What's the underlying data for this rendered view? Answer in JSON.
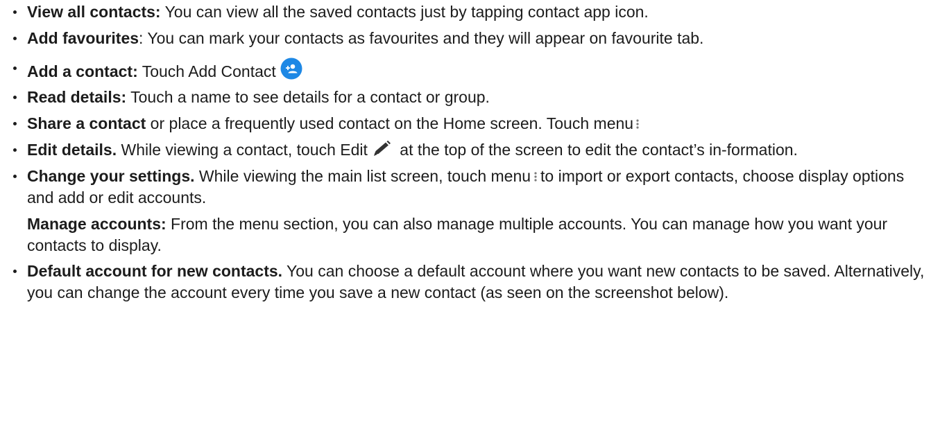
{
  "items": [
    {
      "bold": "View all contacts:",
      "text": " You can view all the saved contacts just by tapping contact app icon."
    },
    {
      "bold": "Add favourites",
      "text": ": You can mark your contacts as favourites and they will appear on favourite tab."
    },
    {
      "bold": "Add a contact:",
      "text": " Touch Add Contact"
    },
    {
      "bold": "Read details:",
      "text": " Touch a name to see details for a contact or group."
    },
    {
      "bold": "Share a contact",
      "text": " or place a frequently used contact on the Home screen. Touch menu"
    },
    {
      "bold": "Edit details.",
      "text_before": " While viewing a contact, touch Edit",
      "text_after": " at the top of the screen to edit the contact’s in-formation."
    },
    {
      "bold": "Change your settings.",
      "text_before": " While viewing the main list screen, touch menu",
      "text_after": "to import or export contacts, choose display options and add or edit accounts."
    },
    {
      "bold": "Default account for new contacts.",
      "text": " You can choose a default account where you want new contacts to be saved. Alternatively, you can change the account every time you save a new contact (as seen on the screenshot below)."
    }
  ],
  "note": {
    "bold": "Manage accounts:",
    "text": " From the menu section, you can also manage multiple accounts. You can manage how you want your contacts to display."
  },
  "icons": {
    "add_contact": "add-contact-icon",
    "menu": "vertical-dots-menu-icon",
    "edit": "pencil-edit-icon"
  },
  "colors": {
    "accent_blue": "#1e88e5",
    "text": "#1c1c1c"
  }
}
